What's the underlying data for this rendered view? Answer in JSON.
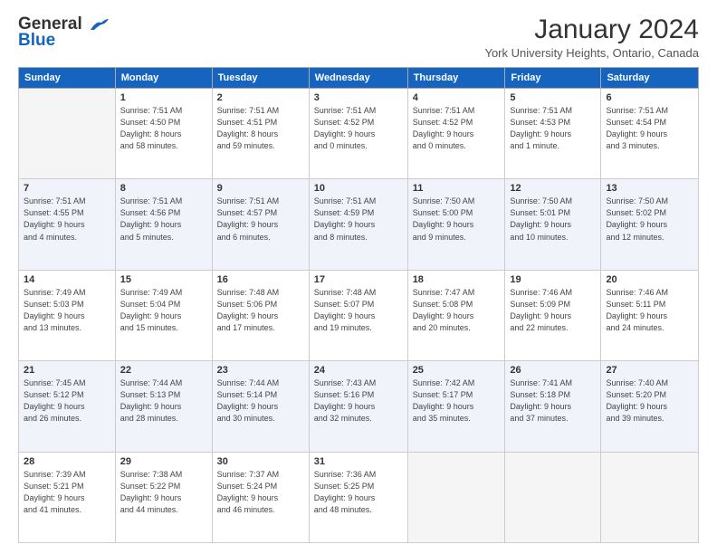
{
  "logo": {
    "line1": "General",
    "line2": "Blue"
  },
  "title": "January 2024",
  "subtitle": "York University Heights, Ontario, Canada",
  "headers": [
    "Sunday",
    "Monday",
    "Tuesday",
    "Wednesday",
    "Thursday",
    "Friday",
    "Saturday"
  ],
  "weeks": [
    [
      {
        "day": "",
        "info": ""
      },
      {
        "day": "1",
        "info": "Sunrise: 7:51 AM\nSunset: 4:50 PM\nDaylight: 8 hours\nand 58 minutes."
      },
      {
        "day": "2",
        "info": "Sunrise: 7:51 AM\nSunset: 4:51 PM\nDaylight: 8 hours\nand 59 minutes."
      },
      {
        "day": "3",
        "info": "Sunrise: 7:51 AM\nSunset: 4:52 PM\nDaylight: 9 hours\nand 0 minutes."
      },
      {
        "day": "4",
        "info": "Sunrise: 7:51 AM\nSunset: 4:52 PM\nDaylight: 9 hours\nand 0 minutes."
      },
      {
        "day": "5",
        "info": "Sunrise: 7:51 AM\nSunset: 4:53 PM\nDaylight: 9 hours\nand 1 minute."
      },
      {
        "day": "6",
        "info": "Sunrise: 7:51 AM\nSunset: 4:54 PM\nDaylight: 9 hours\nand 3 minutes."
      }
    ],
    [
      {
        "day": "7",
        "info": "Sunrise: 7:51 AM\nSunset: 4:55 PM\nDaylight: 9 hours\nand 4 minutes."
      },
      {
        "day": "8",
        "info": "Sunrise: 7:51 AM\nSunset: 4:56 PM\nDaylight: 9 hours\nand 5 minutes."
      },
      {
        "day": "9",
        "info": "Sunrise: 7:51 AM\nSunset: 4:57 PM\nDaylight: 9 hours\nand 6 minutes."
      },
      {
        "day": "10",
        "info": "Sunrise: 7:51 AM\nSunset: 4:59 PM\nDaylight: 9 hours\nand 8 minutes."
      },
      {
        "day": "11",
        "info": "Sunrise: 7:50 AM\nSunset: 5:00 PM\nDaylight: 9 hours\nand 9 minutes."
      },
      {
        "day": "12",
        "info": "Sunrise: 7:50 AM\nSunset: 5:01 PM\nDaylight: 9 hours\nand 10 minutes."
      },
      {
        "day": "13",
        "info": "Sunrise: 7:50 AM\nSunset: 5:02 PM\nDaylight: 9 hours\nand 12 minutes."
      }
    ],
    [
      {
        "day": "14",
        "info": "Sunrise: 7:49 AM\nSunset: 5:03 PM\nDaylight: 9 hours\nand 13 minutes."
      },
      {
        "day": "15",
        "info": "Sunrise: 7:49 AM\nSunset: 5:04 PM\nDaylight: 9 hours\nand 15 minutes."
      },
      {
        "day": "16",
        "info": "Sunrise: 7:48 AM\nSunset: 5:06 PM\nDaylight: 9 hours\nand 17 minutes."
      },
      {
        "day": "17",
        "info": "Sunrise: 7:48 AM\nSunset: 5:07 PM\nDaylight: 9 hours\nand 19 minutes."
      },
      {
        "day": "18",
        "info": "Sunrise: 7:47 AM\nSunset: 5:08 PM\nDaylight: 9 hours\nand 20 minutes."
      },
      {
        "day": "19",
        "info": "Sunrise: 7:46 AM\nSunset: 5:09 PM\nDaylight: 9 hours\nand 22 minutes."
      },
      {
        "day": "20",
        "info": "Sunrise: 7:46 AM\nSunset: 5:11 PM\nDaylight: 9 hours\nand 24 minutes."
      }
    ],
    [
      {
        "day": "21",
        "info": "Sunrise: 7:45 AM\nSunset: 5:12 PM\nDaylight: 9 hours\nand 26 minutes."
      },
      {
        "day": "22",
        "info": "Sunrise: 7:44 AM\nSunset: 5:13 PM\nDaylight: 9 hours\nand 28 minutes."
      },
      {
        "day": "23",
        "info": "Sunrise: 7:44 AM\nSunset: 5:14 PM\nDaylight: 9 hours\nand 30 minutes."
      },
      {
        "day": "24",
        "info": "Sunrise: 7:43 AM\nSunset: 5:16 PM\nDaylight: 9 hours\nand 32 minutes."
      },
      {
        "day": "25",
        "info": "Sunrise: 7:42 AM\nSunset: 5:17 PM\nDaylight: 9 hours\nand 35 minutes."
      },
      {
        "day": "26",
        "info": "Sunrise: 7:41 AM\nSunset: 5:18 PM\nDaylight: 9 hours\nand 37 minutes."
      },
      {
        "day": "27",
        "info": "Sunrise: 7:40 AM\nSunset: 5:20 PM\nDaylight: 9 hours\nand 39 minutes."
      }
    ],
    [
      {
        "day": "28",
        "info": "Sunrise: 7:39 AM\nSunset: 5:21 PM\nDaylight: 9 hours\nand 41 minutes."
      },
      {
        "day": "29",
        "info": "Sunrise: 7:38 AM\nSunset: 5:22 PM\nDaylight: 9 hours\nand 44 minutes."
      },
      {
        "day": "30",
        "info": "Sunrise: 7:37 AM\nSunset: 5:24 PM\nDaylight: 9 hours\nand 46 minutes."
      },
      {
        "day": "31",
        "info": "Sunrise: 7:36 AM\nSunset: 5:25 PM\nDaylight: 9 hours\nand 48 minutes."
      },
      {
        "day": "",
        "info": ""
      },
      {
        "day": "",
        "info": ""
      },
      {
        "day": "",
        "info": ""
      }
    ]
  ]
}
